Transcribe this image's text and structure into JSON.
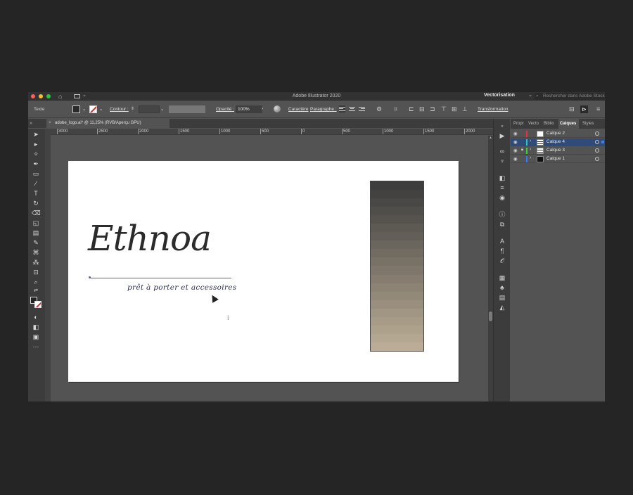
{
  "window": {
    "app_title": "Adobe Illustrator 2020",
    "workspace": "Vectorisation",
    "stock_search_placeholder": "Rechercher dans Adobe Stock"
  },
  "control_bar": {
    "selection_type": "Texte",
    "contour_label": "Contour :",
    "opacity_label": "Opacité :",
    "opacity_value": "100%",
    "caractere_label": "Caractère",
    "paragraphe_label": "Paragraphe :",
    "transformation_label": "Transformation",
    "colors": {
      "fill": "#2a2a2a",
      "stroke": "none"
    }
  },
  "document_tab": {
    "title": "adobe_logo.ai* @ 11,25% (RVB/Aperçu GPU)",
    "close_glyph": "×"
  },
  "ruler": {
    "labels": [
      "3000",
      "2500",
      "2000",
      "1500",
      "1000",
      "500",
      "0",
      "500",
      "1000",
      "1500",
      "2000"
    ]
  },
  "artboard": {
    "logo_text": "Ethnoa",
    "tagline": "prêt à porter et accessoires",
    "gradient_swatches": [
      "#3d3d3d",
      "#434241",
      "#4a4846",
      "#504e4a",
      "#56534f",
      "#5d5953",
      "#635f58",
      "#6a655d",
      "#716b62",
      "#787166",
      "#7f776b",
      "#867d70",
      "#8c8374",
      "#938979",
      "#9a8f7e",
      "#a19583",
      "#a79b88",
      "#aea18c",
      "#b4a791",
      "#baac96"
    ]
  },
  "panels": {
    "tabs": [
      "Propr",
      "Vecto",
      "Biblio",
      "Calques",
      "Styles"
    ],
    "active_tab": "Calques",
    "layers": [
      {
        "name": "Calque 2",
        "color": "#e8323c",
        "selected": false,
        "locked": false
      },
      {
        "name": "Calque 4",
        "color": "#31c4c4",
        "selected": true,
        "locked": false
      },
      {
        "name": "Calque 3",
        "color": "#3cd23c",
        "selected": false,
        "locked": true
      },
      {
        "name": "Calque 1",
        "color": "#3c78ff",
        "selected": false,
        "locked": false
      }
    ]
  }
}
